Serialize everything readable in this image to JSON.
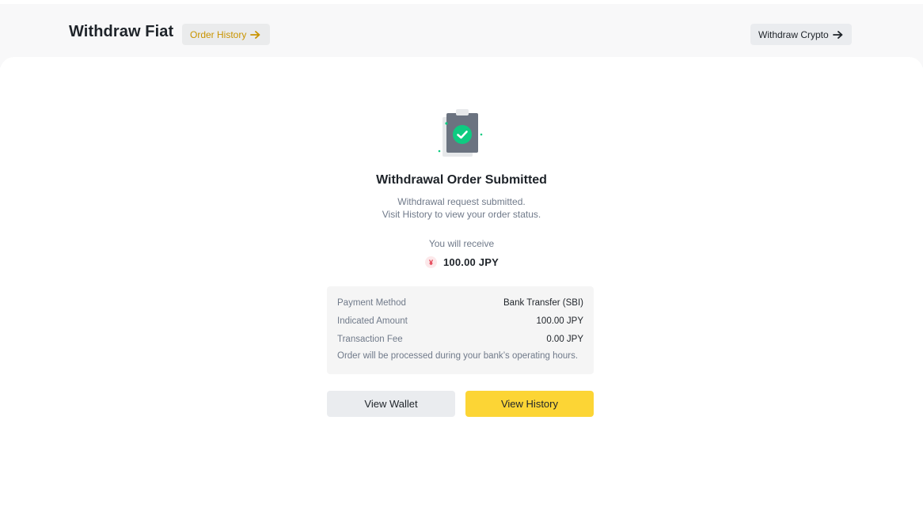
{
  "header": {
    "title": "Withdraw Fiat",
    "order_history_label": "Order History",
    "withdraw_crypto_label": "Withdraw Crypto",
    "accent_color": "#c99400"
  },
  "result": {
    "icon": "clipboard-check-icon",
    "title": "Withdrawal Order Submitted",
    "line1": "Withdrawal request submitted.",
    "line2": "Visit History to view your order status.",
    "receive_label": "You will receive",
    "currency_symbol": "¥",
    "amount": "100.00 JPY"
  },
  "details": {
    "rows": [
      {
        "label": "Payment Method",
        "value": "Bank Transfer (SBI)"
      },
      {
        "label": "Indicated Amount",
        "value": "100.00 JPY"
      },
      {
        "label": "Transaction Fee",
        "value": "0.00 JPY"
      }
    ],
    "note": "Order will be processed during your bank’s operating hours."
  },
  "actions": {
    "view_wallet": "View Wallet",
    "view_history": "View History",
    "primary_color": "#fcd535"
  }
}
